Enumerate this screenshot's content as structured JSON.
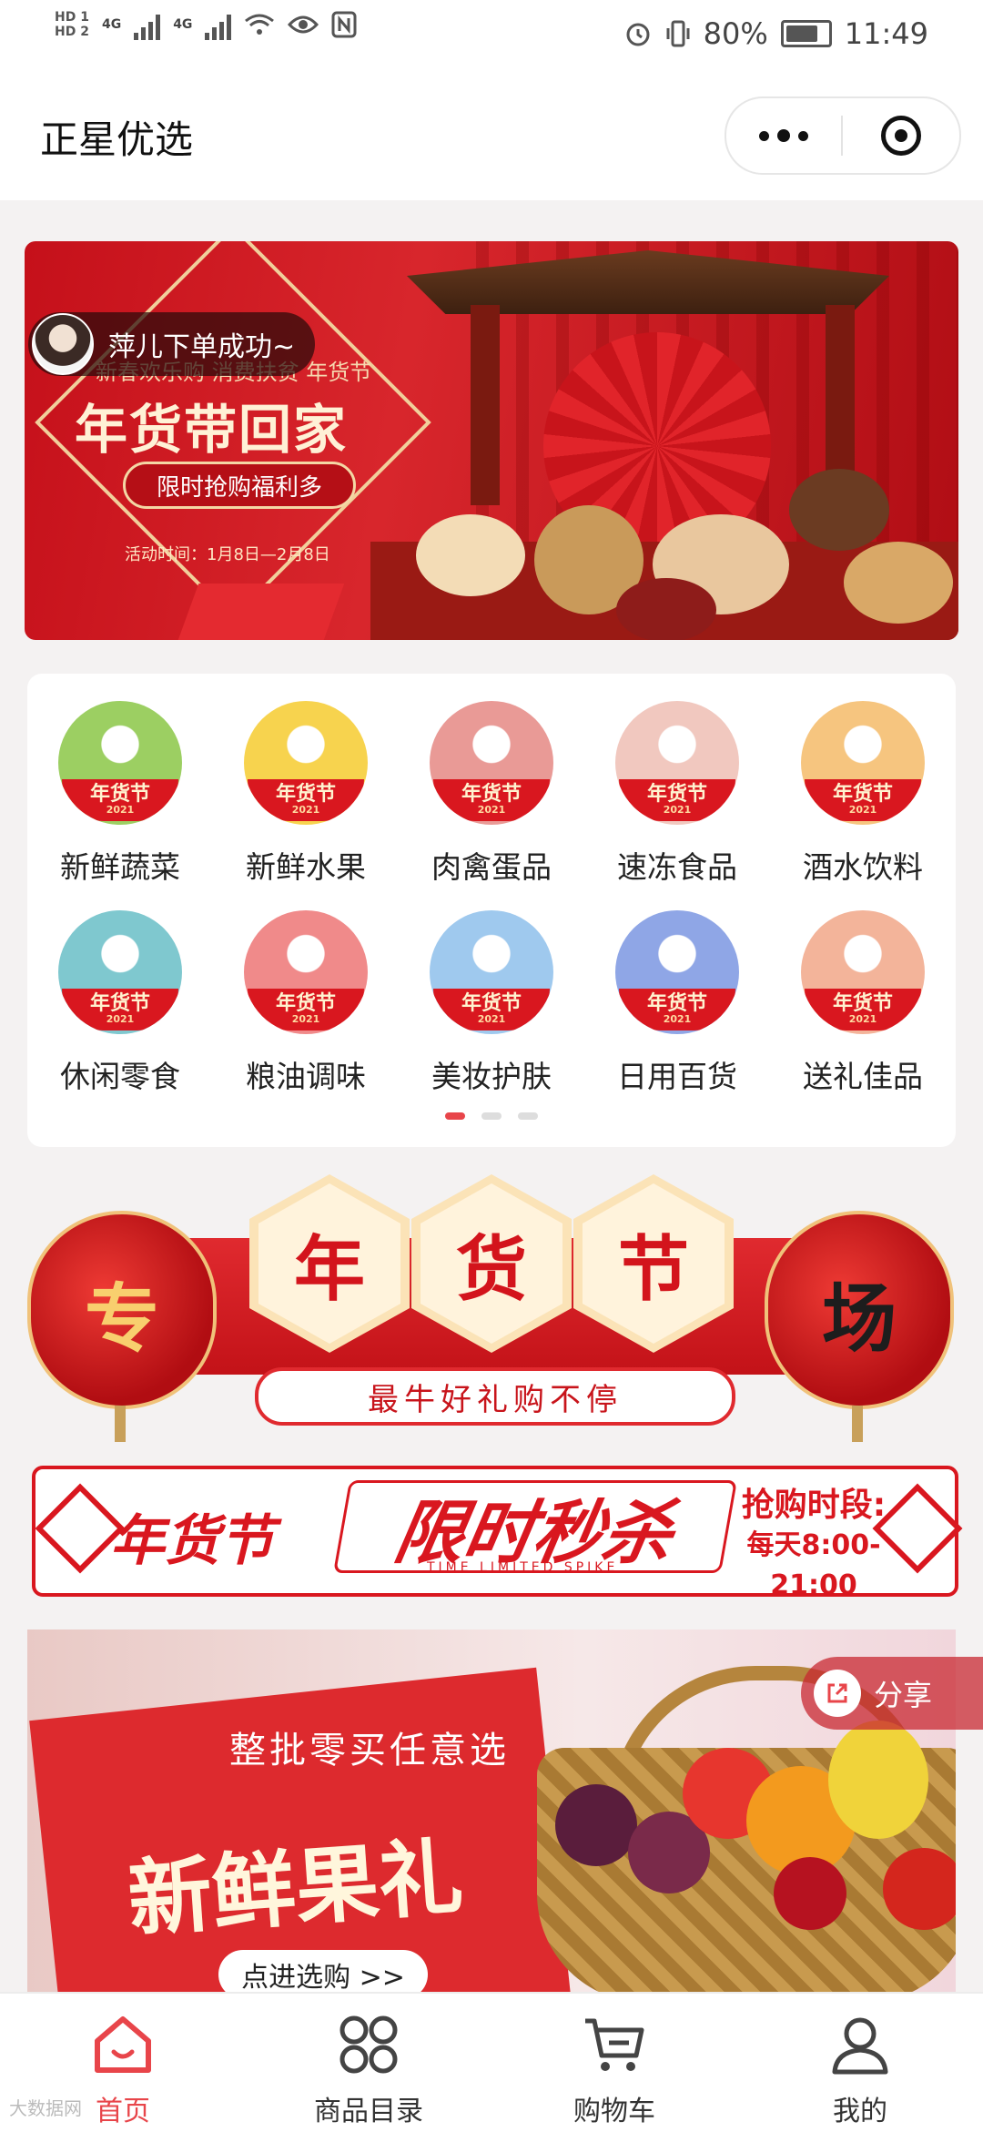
{
  "status_bar": {
    "hd1": "HD 1",
    "hd2": "HD 2",
    "net1": "4G",
    "net2": "4G",
    "battery": "80%",
    "time": "11:49"
  },
  "header": {
    "title": "正星优选"
  },
  "banner": {
    "notification": "萍儿下单成功~",
    "subtitle": "新春欢乐购  消费扶贫  年货节",
    "main_text": "年货带回家",
    "pill_text": "限时抢购福利多",
    "date_text": "活动时间：1月8日—2月8日"
  },
  "categories": [
    {
      "label": "新鲜蔬菜",
      "icon": "vegetables-icon",
      "color": "#9ccf62"
    },
    {
      "label": "新鲜水果",
      "icon": "fruits-icon",
      "color": "#f7d34e"
    },
    {
      "label": "肉禽蛋品",
      "icon": "meat-icon",
      "color": "#e99a96"
    },
    {
      "label": "速冻食品",
      "icon": "frozen-food-icon",
      "color": "#f1c8bf"
    },
    {
      "label": "酒水饮料",
      "icon": "drinks-icon",
      "color": "#f6c57f"
    },
    {
      "label": "休闲零食",
      "icon": "snacks-icon",
      "color": "#7fc8cf"
    },
    {
      "label": "粮油调味",
      "icon": "grain-oil-icon",
      "color": "#f08a8a"
    },
    {
      "label": "美妆护肤",
      "icon": "cosmetics-icon",
      "color": "#9fc9ee"
    },
    {
      "label": "日用百货",
      "icon": "daily-goods-icon",
      "color": "#8fa6e6"
    },
    {
      "label": "送礼佳品",
      "icon": "gifts-icon",
      "color": "#f3b49a"
    }
  ],
  "category_badge": {
    "text": "年货节",
    "year": "2021"
  },
  "carousel": {
    "pages": 3,
    "active": 0
  },
  "festival": {
    "left": "专",
    "right": "场",
    "hex": [
      "年",
      "货",
      "节"
    ],
    "subtitle": "最牛好礼购不停"
  },
  "flash_sale": {
    "label": "年货节",
    "title": "限时秒杀",
    "english": "TIME LIMITED SPIKE",
    "time_label": "抢购时段:",
    "time_value": "每天8:00-21:00"
  },
  "fruit_banner": {
    "subtitle": "整批零买任意选",
    "title": "新鲜果礼",
    "button": "点进选购 >>"
  },
  "share": {
    "label": "分享"
  },
  "tabs": [
    {
      "label": "首页",
      "icon": "home-icon",
      "active": true
    },
    {
      "label": "商品目录",
      "icon": "catalog-icon",
      "active": false
    },
    {
      "label": "购物车",
      "icon": "cart-icon",
      "active": false
    },
    {
      "label": "我的",
      "icon": "profile-icon",
      "active": false
    }
  ],
  "watermark": "大数据网",
  "colors": {
    "accent": "#e8454a",
    "festival_red": "#d9171f",
    "gold": "#f1cf9b"
  }
}
